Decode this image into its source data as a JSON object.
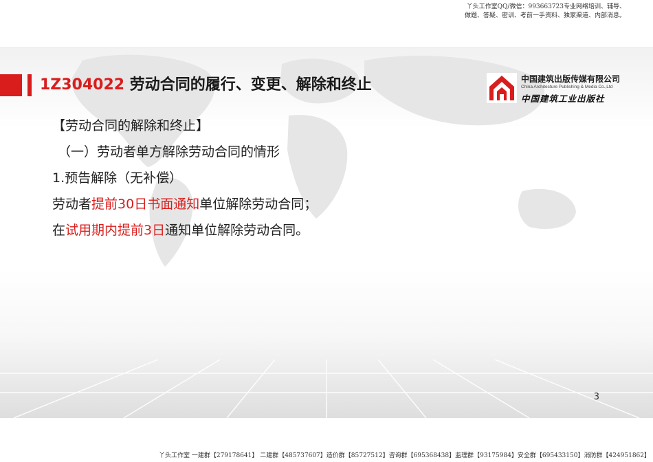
{
  "header_note": {
    "line1": "丫头工作室QQ/微信：993663723专业网络培训、辅导、",
    "line2": "做题、答疑、密训、考前一手资料、独家渠道、内部消息。"
  },
  "slide": {
    "title_code": "1Z304022",
    "title_text": " 劳动合同的履行、变更、解除和终止",
    "logo": {
      "cn": "中国建筑出版传媒有限公司",
      "en": "China Architecture Publishing & Media Co.,Ltd",
      "cn2": "中国建筑工业出版社"
    },
    "lines": {
      "l1": "【劳动合同的解除和终止】",
      "l2": "（一）劳动者单方解除劳动合同的情形",
      "l3": "1.预告解除（无补偿）",
      "l4_a": "劳动者",
      "l4_b": "提前30日书面通知",
      "l4_c": "单位解除劳动合同；",
      "l5_a": "在",
      "l5_b": "试用期内提前3日",
      "l5_c": "通知单位解除劳动合同。"
    },
    "page_number": "3"
  },
  "footer_note": "丫头工作室  一建群【279178641】  二建群【485737607】造价群【85727512】咨询群【695368438】监理群【93175984】安全群【695433150】消防群【424951862】",
  "colors": {
    "accent_red": "#d91d1d",
    "text": "#222222"
  }
}
